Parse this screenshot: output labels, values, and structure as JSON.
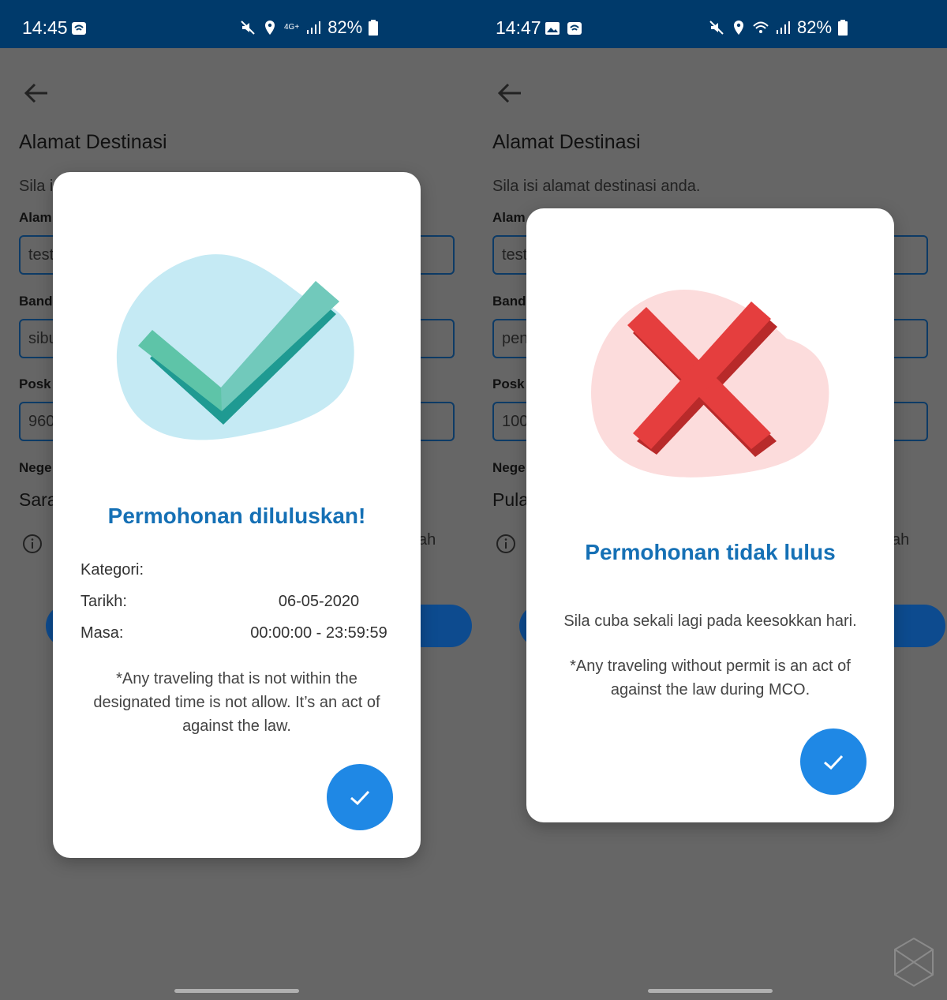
{
  "left": {
    "status": {
      "time": "14:45",
      "network": "4G+",
      "battery": "82%"
    },
    "page": {
      "title": "Alamat Destinasi",
      "subtitle": "Sila i",
      "fields": [
        {
          "label": "Alam",
          "value": "test"
        },
        {
          "label": "Band",
          "value": "sibu"
        },
        {
          "label": "Posk",
          "value": "960"
        }
      ],
      "state_label": "Nege",
      "state_value": "Sara",
      "info_tail": "ah"
    },
    "dialog": {
      "title": "Permohonan diluluskan!",
      "details": [
        {
          "label": "Kategori:",
          "value": ""
        },
        {
          "label": "Tarikh:",
          "value": "06-05-2020"
        },
        {
          "label": "Masa:",
          "value": "00:00:00 - 23:59:59"
        }
      ],
      "note": "*Any traveling that is not within the designated time is not allow. It’s an act of against the law.",
      "confirm_icon": "check-icon",
      "illustration_icon": "check-icon",
      "accent": "#1570b5",
      "blob_color": "#c5eaf4"
    }
  },
  "right": {
    "status": {
      "time": "14:47",
      "battery": "82%"
    },
    "page": {
      "title": "Alamat Destinasi",
      "subtitle": "Sila isi alamat destinasi anda.",
      "fields": [
        {
          "label": "Alam",
          "value": "test"
        },
        {
          "label": "Band",
          "value": "pen"
        },
        {
          "label": "Posk",
          "value": "100"
        }
      ],
      "state_label": "Nege",
      "state_value": "Pula",
      "info_tail": "ah"
    },
    "dialog": {
      "title": "Permohonan tidak lulus",
      "message": "Sila cuba sekali lagi pada keesokkan hari.",
      "note": "*Any traveling without permit is an act of against the law during MCO.",
      "confirm_icon": "check-icon",
      "illustration_icon": "cross-icon",
      "accent": "#1570b5",
      "blob_color": "#fcdcdc",
      "cross_color": "#e53e3e"
    }
  }
}
